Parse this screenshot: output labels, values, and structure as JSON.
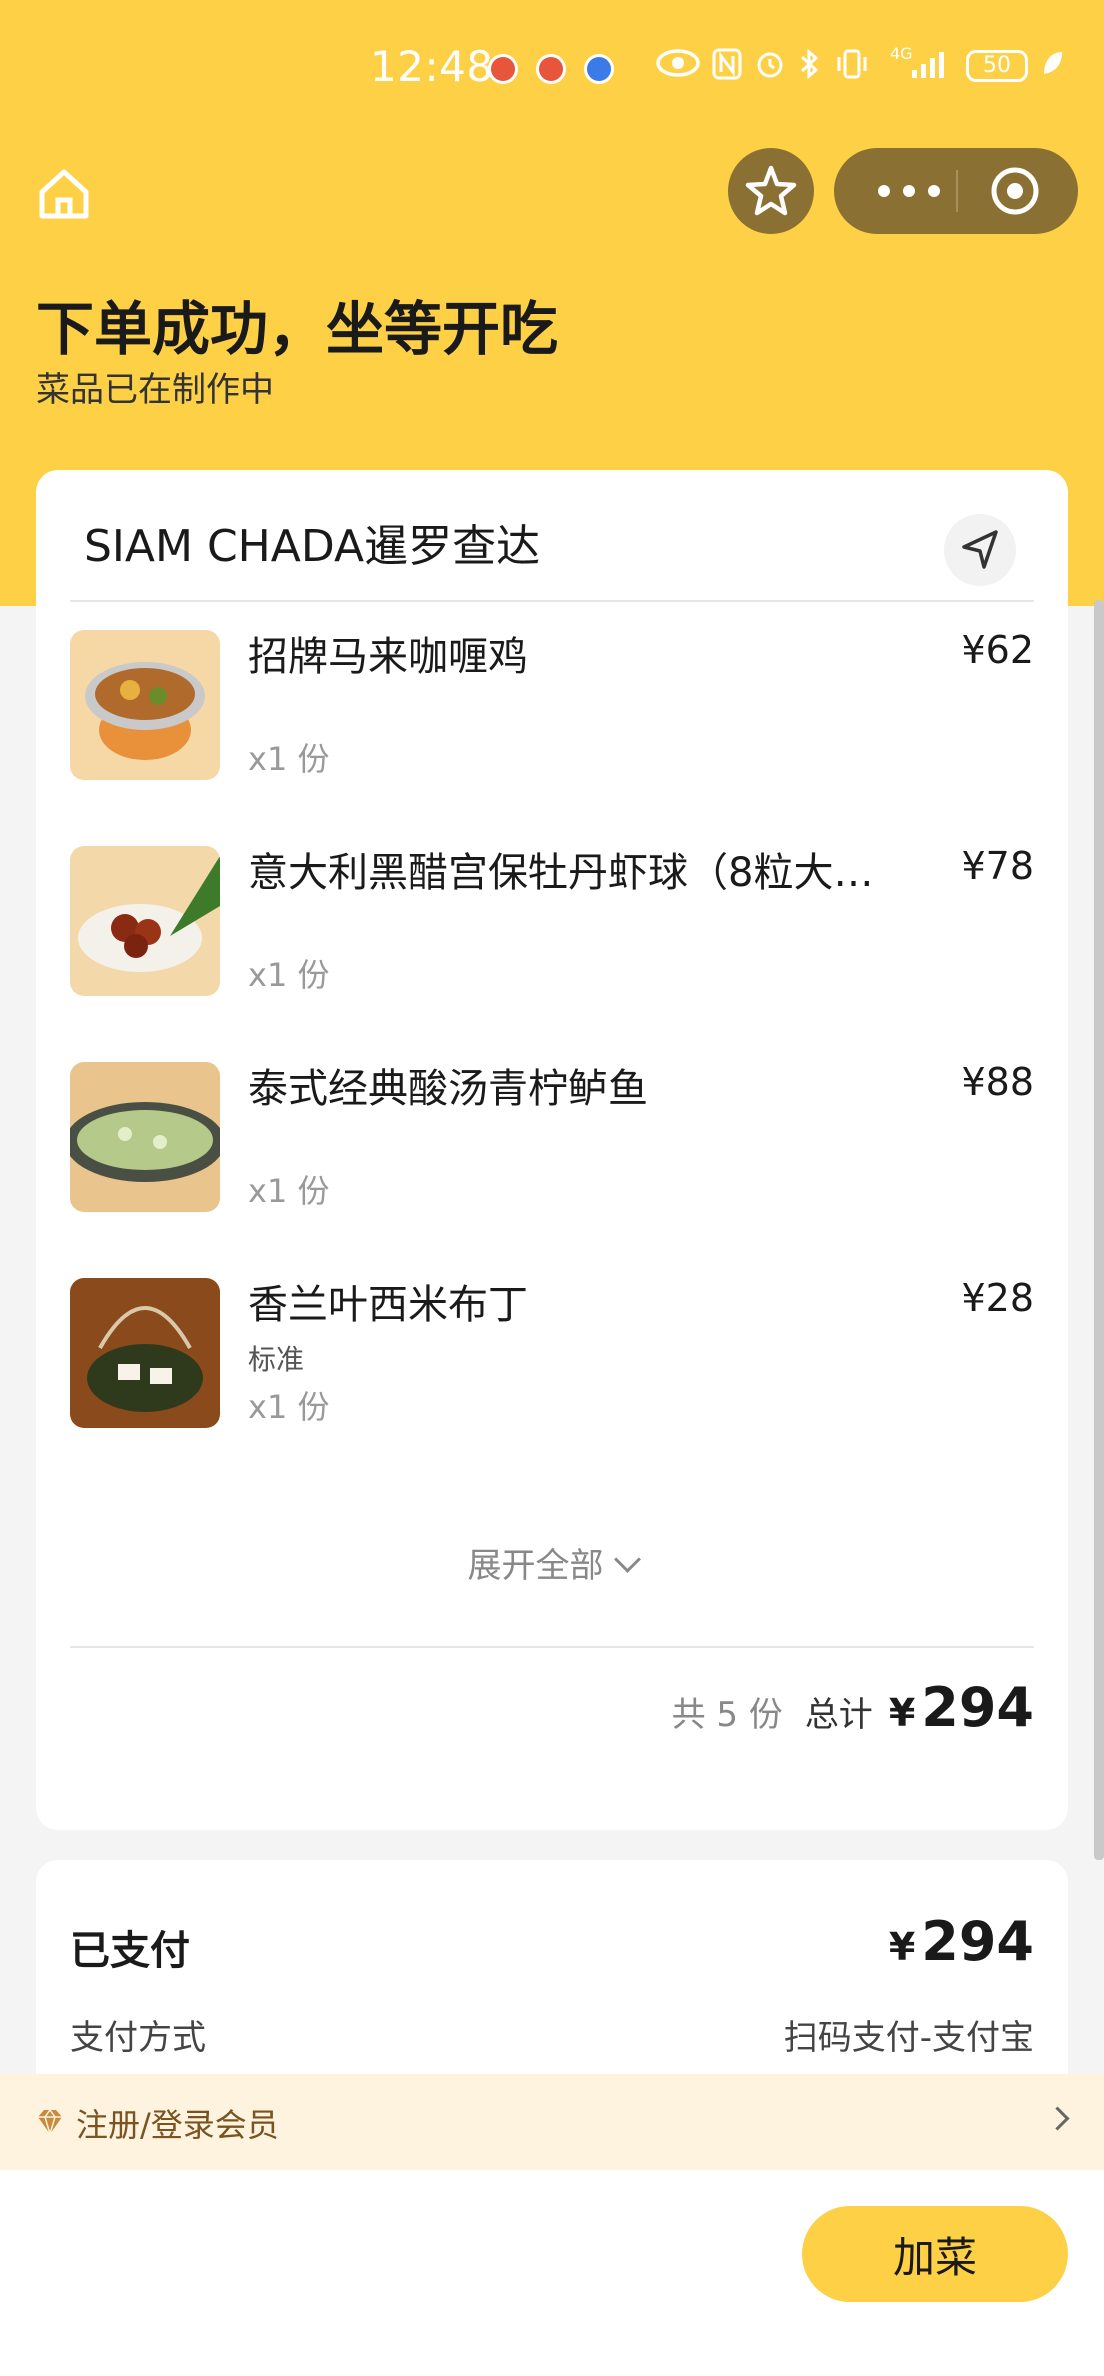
{
  "status_bar": {
    "time": "12:48",
    "network": "4G",
    "battery": "50"
  },
  "header": {
    "title": "下单成功，坐等开吃",
    "subtitle": "菜品已在制作中"
  },
  "order": {
    "shop_name": "SIAM CHADA暹罗查达",
    "items": [
      {
        "name": "招牌马来咖喱鸡",
        "spec": "",
        "qty": "x1 份",
        "price": "¥62"
      },
      {
        "name": "意大利黑醋宫保牡丹虾球（8粒大…",
        "spec": "",
        "qty": "x1 份",
        "price": "¥78"
      },
      {
        "name": "泰式经典酸汤青柠鲈鱼",
        "spec": "",
        "qty": "x1 份",
        "price": "¥88"
      },
      {
        "name": "香兰叶西米布丁",
        "spec": "标准",
        "qty": "x1 份",
        "price": "¥28"
      }
    ],
    "expand_label": "展开全部",
    "count_label": "共 5 份",
    "total_label": "总计",
    "currency": "¥",
    "total": "294"
  },
  "payment": {
    "paid_label": "已支付",
    "currency": "¥",
    "paid_amount": "294",
    "method_label": "支付方式",
    "method_value": "扫码支付-支付宝"
  },
  "member_bar": {
    "label": "注册/登录会员"
  },
  "actions": {
    "add_dish": "加菜"
  },
  "colors": {
    "brand_yellow": "#fdd046",
    "capsule_brown": "#8a7032",
    "member_bg": "#fdf3df"
  }
}
